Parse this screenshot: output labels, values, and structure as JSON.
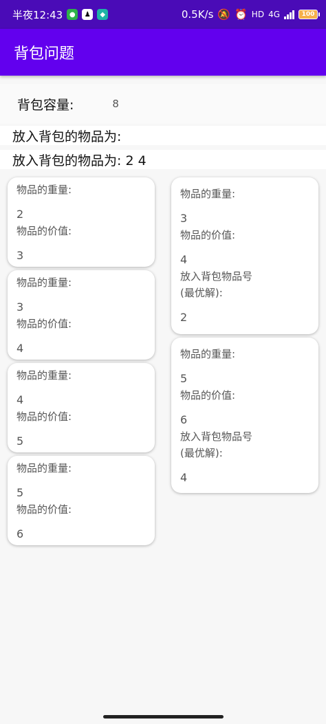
{
  "status_bar": {
    "time": "半夜12:43",
    "net_speed": "0.5K/s",
    "hd": "HD",
    "network": "4G",
    "battery": "100"
  },
  "app_bar": {
    "title": "背包问题"
  },
  "capacity": {
    "label": "背包容量:",
    "value": "8"
  },
  "results": {
    "line1": "放入背包的物品为:",
    "line2": "放入背包的物品为: 2 4"
  },
  "labels": {
    "weight": "物品的重量:",
    "value": "物品的价值:",
    "item_no": "放入背包物品号\n(最优解):"
  },
  "items_left": [
    {
      "weight": "2",
      "value": "3"
    },
    {
      "weight": "3",
      "value": "4"
    },
    {
      "weight": "4",
      "value": "5"
    },
    {
      "weight": "5",
      "value": "6"
    }
  ],
  "items_right": [
    {
      "weight": "3",
      "value": "4",
      "item_no": "2"
    },
    {
      "weight": "5",
      "value": "6",
      "item_no": "4"
    }
  ],
  "colors": {
    "status_bar": "#4a0bb7",
    "app_bar": "#6200ee"
  }
}
